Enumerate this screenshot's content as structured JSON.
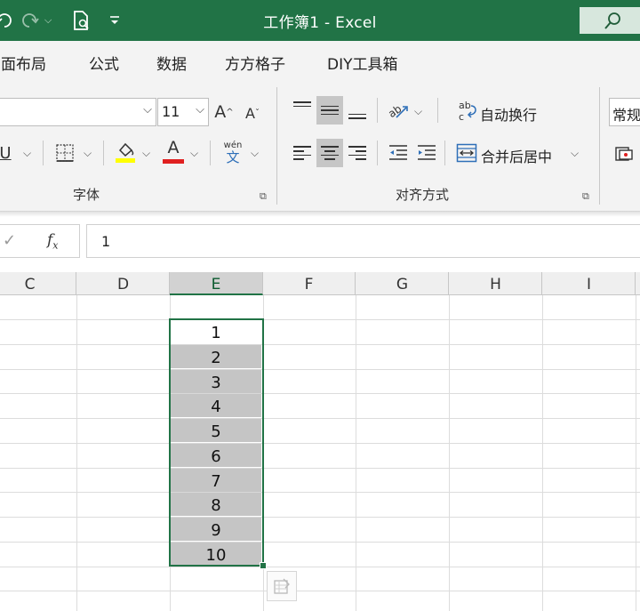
{
  "titlebar": {
    "title": "工作簿1  -  Excel",
    "accent": "#217346"
  },
  "menu": {
    "tabs": [
      {
        "label": "页面布局"
      },
      {
        "label": "公式"
      },
      {
        "label": "数据"
      },
      {
        "label": "方方格子"
      },
      {
        "label": "DIY工具箱"
      }
    ]
  },
  "ribbon": {
    "font_size": "11",
    "number_format": "常规",
    "phonetic_label": "wén",
    "phonetic_char": "文",
    "wrap_text": "自动换行",
    "merge_center": "合并后居中",
    "groups": {
      "font": "字体",
      "alignment": "对齐方式"
    },
    "fill_color": "#ffff00",
    "font_color": "#e02020"
  },
  "formula_bar": {
    "value": "1"
  },
  "grid": {
    "columns": [
      "C",
      "D",
      "E",
      "F",
      "G",
      "H",
      "I"
    ],
    "selected_column": "E",
    "cells": [
      "1",
      "2",
      "3",
      "4",
      "5",
      "6",
      "7",
      "8",
      "9",
      "10"
    ]
  }
}
